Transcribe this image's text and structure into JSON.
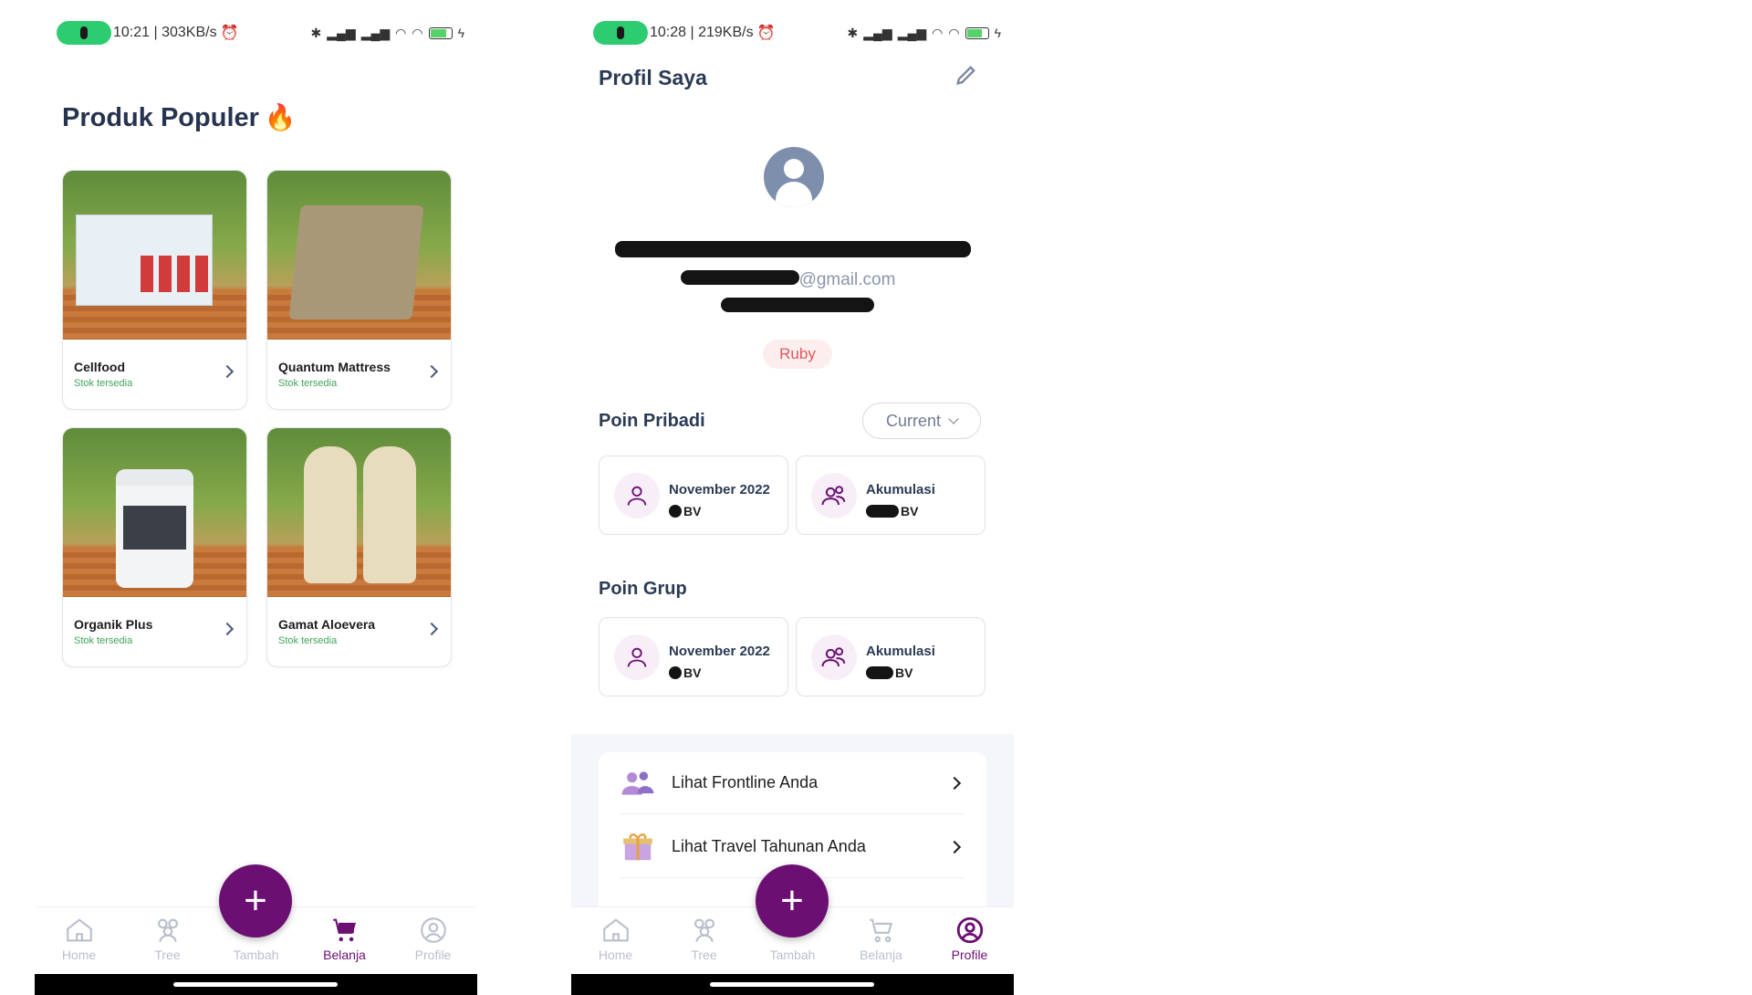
{
  "left_screen": {
    "status": {
      "time_speed": "10:21 | 303KB/s",
      "battery": "77"
    },
    "heading": "Produk Populer",
    "products": [
      {
        "name": "Cellfood",
        "stock": "Stok tersedia"
      },
      {
        "name": "Quantum Mattress",
        "stock": "Stok tersedia"
      },
      {
        "name": "Organik Plus",
        "stock": "Stok tersedia"
      },
      {
        "name": "Gamat Aloevera",
        "stock": "Stok tersedia"
      }
    ],
    "nav": {
      "home": "Home",
      "tree": "Tree",
      "tambah": "Tambah",
      "belanja": "Belanja",
      "profile": "Profile",
      "active": "Belanja"
    }
  },
  "right_screen": {
    "status": {
      "time_speed": "10:28 | 219KB/s",
      "battery": "76"
    },
    "title": "Profil Saya",
    "email_suffix": "@gmail.com",
    "rank": "Ruby",
    "poin_pribadi": {
      "label": "Poin Pribadi",
      "period_select": "Current",
      "cards": [
        {
          "label": "November 2022",
          "unit": "BV"
        },
        {
          "label": "Akumulasi",
          "unit": "BV"
        }
      ]
    },
    "poin_grup": {
      "label": "Poin Grup",
      "cards": [
        {
          "label": "November 2022",
          "unit": "BV"
        },
        {
          "label": "Akumulasi",
          "unit": "BV"
        }
      ]
    },
    "menu": [
      {
        "label": "Lihat Frontline Anda",
        "icon": "people-icon"
      },
      {
        "label": "Lihat Travel Tahunan Anda",
        "icon": "gift-icon"
      }
    ],
    "nav": {
      "home": "Home",
      "tree": "Tree",
      "tambah": "Tambah",
      "belanja": "Belanja",
      "profile": "Profile",
      "active": "Profile"
    }
  },
  "colors": {
    "brand": "#6b0f72",
    "stock_green": "#3fa55b",
    "rank_red": "#e0565f",
    "heading": "#27344f"
  }
}
